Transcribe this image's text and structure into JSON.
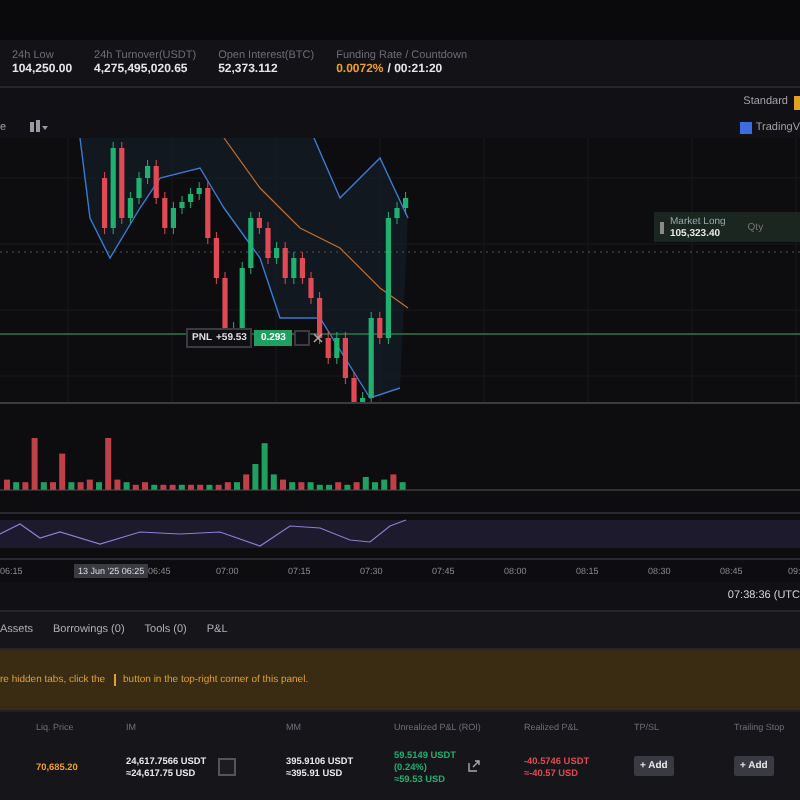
{
  "stats": [
    {
      "label": "24h Low",
      "value": "104,250.00",
      "kind": "plain"
    },
    {
      "label": "24h Turnover(USDT)",
      "value": "4,275,495,020.65",
      "kind": "plain"
    },
    {
      "label": "Open Interest(BTC)",
      "value": "52,373.112",
      "kind": "plain"
    },
    {
      "label": "Funding Rate / Countdown",
      "value": "0.0072%",
      "extra": "/ 00:21:20",
      "kind": "funding"
    }
  ],
  "chart_toolbar": {
    "style_label": "Standard",
    "menu_cut": "e",
    "tradingview": "TradingV"
  },
  "chart": {
    "pnl_label": "PNL",
    "pnl_value": "+59.53",
    "position_size": "0.293",
    "order_side": "Market Long",
    "order_price": "105,323.40",
    "qty_placeholder": "Qty"
  },
  "time_axis": [
    {
      "label": "06:15",
      "selected": false
    },
    {
      "label": "13 Jun '25  06:25",
      "selected": true
    },
    {
      "label": "06:45",
      "selected": false
    },
    {
      "label": "07:00",
      "selected": false
    },
    {
      "label": "07:15",
      "selected": false
    },
    {
      "label": "07:30",
      "selected": false
    },
    {
      "label": "07:45",
      "selected": false
    },
    {
      "label": "08:00",
      "selected": false
    },
    {
      "label": "08:15",
      "selected": false
    },
    {
      "label": "08:30",
      "selected": false
    },
    {
      "label": "08:45",
      "selected": false
    },
    {
      "label": "09:",
      "selected": false
    }
  ],
  "clock": "07:38:36 (UTC",
  "tabs": [
    {
      "label": "Assets",
      "selected": false
    },
    {
      "label": "Borrowings (0)",
      "selected": false
    },
    {
      "label": "Tools (0)",
      "selected": false
    },
    {
      "label": "P&L",
      "selected": false
    }
  ],
  "banner": {
    "before": "re hidden tabs, click the",
    "after": "button in the top-right corner of this panel."
  },
  "table": {
    "columns": [
      "Liq. Price",
      "IM",
      "MM",
      "Unrealized P&L (ROI)",
      "Realized P&L",
      "TP/SL",
      "Trailing Stop"
    ],
    "row": {
      "liq_price": "70,685.20",
      "im": [
        "24,617.7566 USDT",
        "≈24,617.75 USD"
      ],
      "mm": [
        "395.9106 USDT",
        "≈395.91 USD"
      ],
      "unrealized": [
        "59.5149 USDT",
        "(0.24%)",
        "≈59.53 USD"
      ],
      "realized": [
        "-40.5746 USDT",
        "≈-40.57 USD"
      ],
      "tpsl_button": "+ Add",
      "trailing_button": "+ Add"
    }
  }
}
